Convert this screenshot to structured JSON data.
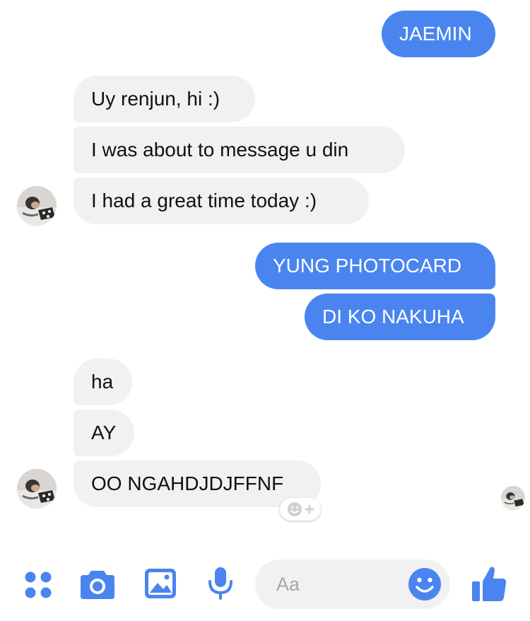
{
  "colors": {
    "outgoing_bubble": "#4a85ef",
    "incoming_bubble": "#f1f1f1",
    "accent": "#4a85ef"
  },
  "messages": [
    {
      "direction": "outgoing",
      "text": "JAEMIN"
    },
    {
      "direction": "incoming",
      "text": "Uy renjun, hi :)"
    },
    {
      "direction": "incoming",
      "text": "I was about to message u din"
    },
    {
      "direction": "incoming",
      "text": "I had a great time today :)"
    },
    {
      "direction": "outgoing",
      "text": "YUNG PHOTOCARD"
    },
    {
      "direction": "outgoing",
      "text": "DI KO NAKUHA"
    },
    {
      "direction": "incoming",
      "text": "ha"
    },
    {
      "direction": "incoming",
      "text": "AY"
    },
    {
      "direction": "incoming",
      "text": "OO NGAHDJDJFFNF"
    }
  ],
  "composer": {
    "placeholder": "Aa",
    "icons": [
      "apps-grid-icon",
      "camera-icon",
      "photo-icon",
      "microphone-icon",
      "emoji-icon",
      "thumbs-up-icon"
    ]
  }
}
